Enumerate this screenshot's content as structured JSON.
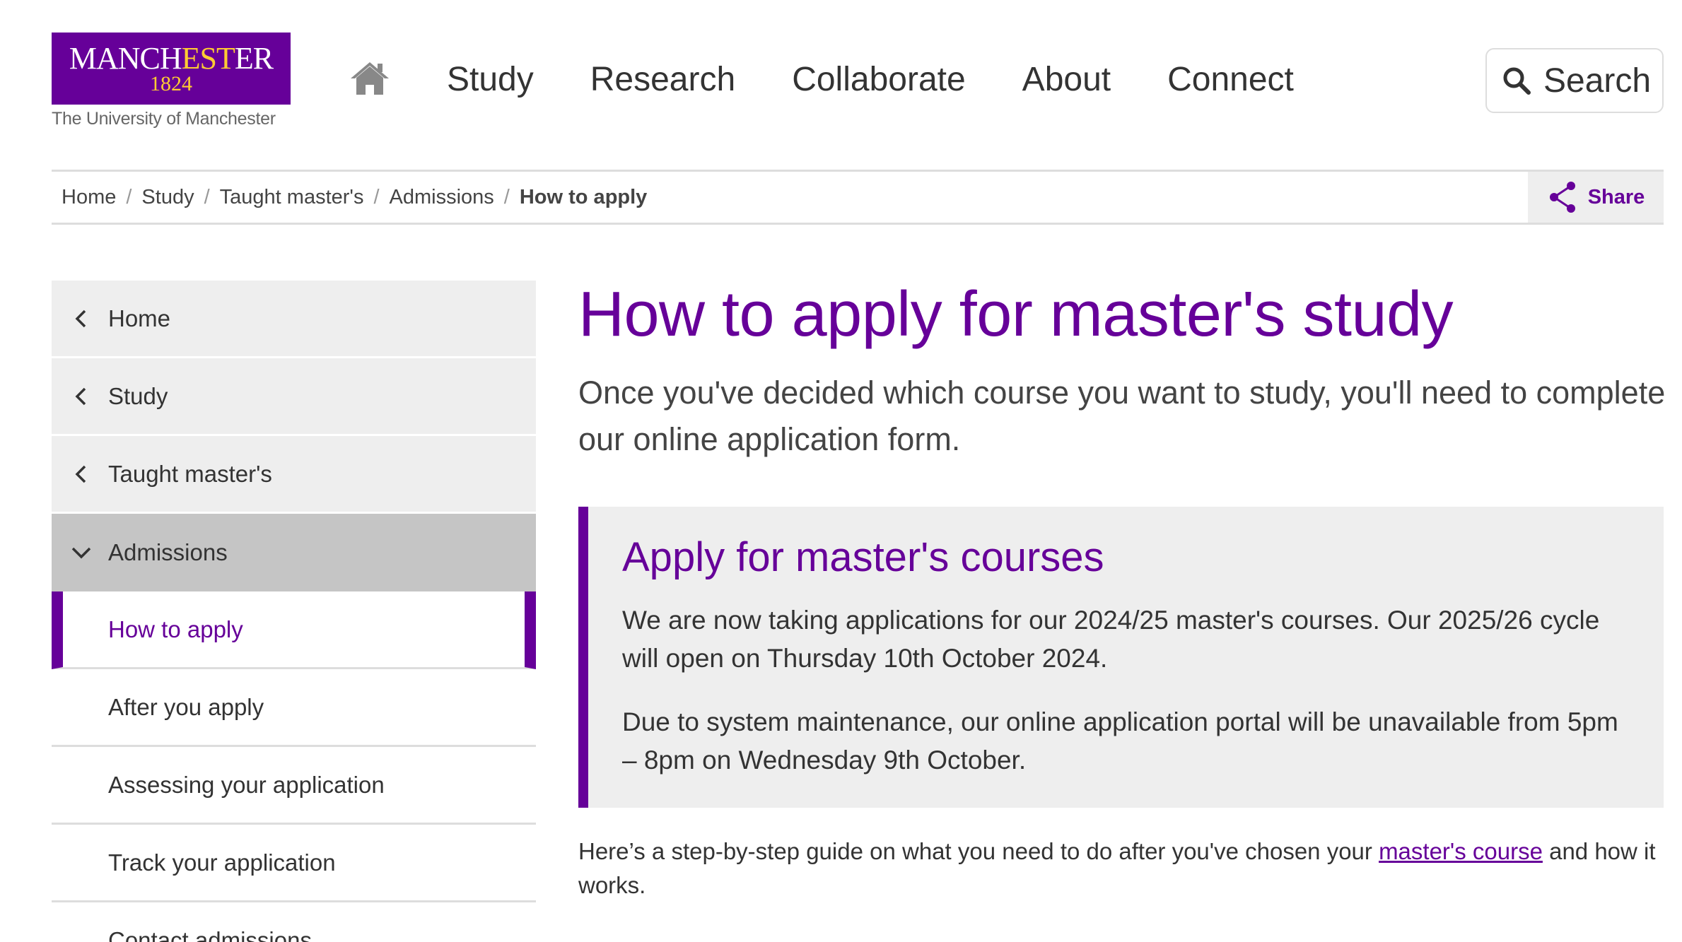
{
  "logo": {
    "word_start": "MANCH",
    "word_mid": "EST",
    "word_end": "ER",
    "year": "1824",
    "tagline": "The University of Manchester"
  },
  "nav": {
    "items": [
      {
        "label": "Study"
      },
      {
        "label": "Research"
      },
      {
        "label": "Collaborate"
      },
      {
        "label": "About"
      },
      {
        "label": "Connect"
      }
    ],
    "search_label": "Search"
  },
  "breadcrumb": {
    "items": [
      "Home",
      "Study",
      "Taught master's",
      "Admissions"
    ],
    "current": "How to apply",
    "separator": "/",
    "share_label": "Share"
  },
  "sidebar": {
    "parents": [
      "Home",
      "Study",
      "Taught master's"
    ],
    "open": "Admissions",
    "current": "How to apply",
    "children": [
      "After you apply",
      "Assessing your application",
      "Track your application",
      "Contact admissions"
    ]
  },
  "main": {
    "title": "How to apply for master's study",
    "lead": "Once you've decided which course you want to study, you'll need to complete our online application form.",
    "notice": {
      "heading": "Apply for master's courses",
      "p1": "We are now taking applications for our 2024/25 master's courses. Our 2025/26 cycle will open on Thursday 10th October 2024.",
      "p2": "Due to system maintenance, our online application portal will be unavailable from 5pm – 8pm on Wednesday 9th October."
    },
    "guide_before": "Here’s a step-by-step guide on what you need to do after you've chosen your ",
    "guide_link": "master's course",
    "guide_after": " and how it works."
  },
  "colors": {
    "brand_purple": "#660099",
    "brand_gold": "#FFCC33",
    "panel_grey": "#EEEEEE",
    "active_grey": "#C5C5C5"
  }
}
